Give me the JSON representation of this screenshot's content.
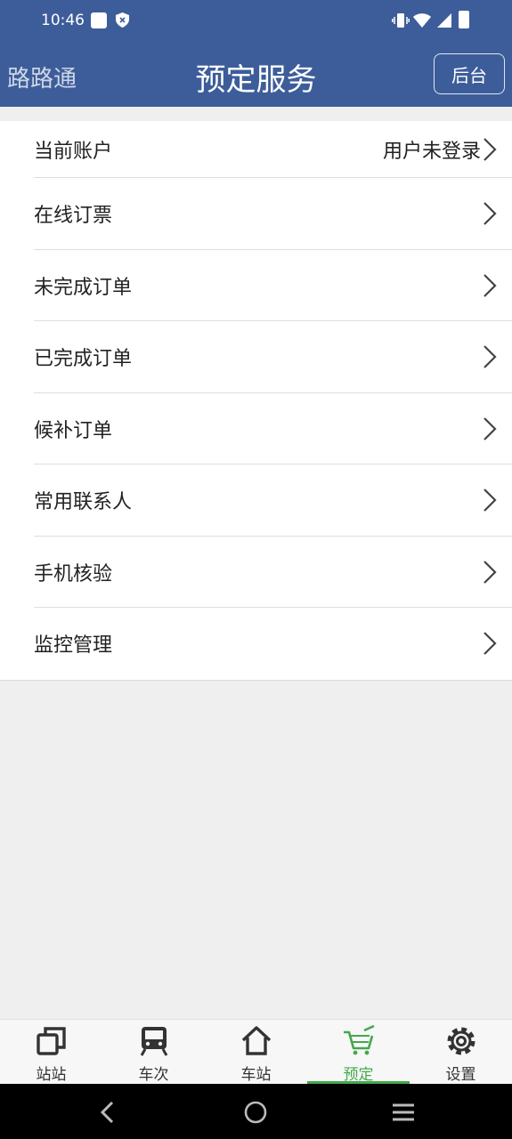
{
  "status_bar": {
    "time": "10:46"
  },
  "header": {
    "brand": "路路通",
    "title": "预定服务",
    "admin_label": "后台"
  },
  "menu": {
    "items": [
      {
        "label": "当前账户",
        "value": "用户未登录"
      },
      {
        "label": "在线订票"
      },
      {
        "label": "未完成订单"
      },
      {
        "label": "已完成订单"
      },
      {
        "label": "候补订单"
      },
      {
        "label": "常用联系人"
      },
      {
        "label": "手机核验"
      },
      {
        "label": "监控管理"
      }
    ]
  },
  "tabs": [
    {
      "label": "站站",
      "icon": "copy-icon"
    },
    {
      "label": "车次",
      "icon": "train-icon"
    },
    {
      "label": "车站",
      "icon": "home-icon"
    },
    {
      "label": "预定",
      "icon": "cart-icon",
      "active": true
    },
    {
      "label": "设置",
      "icon": "gear-icon"
    }
  ],
  "colors": {
    "header": "#3d5d9a",
    "accent": "#45a84c",
    "background": "#efefef"
  }
}
